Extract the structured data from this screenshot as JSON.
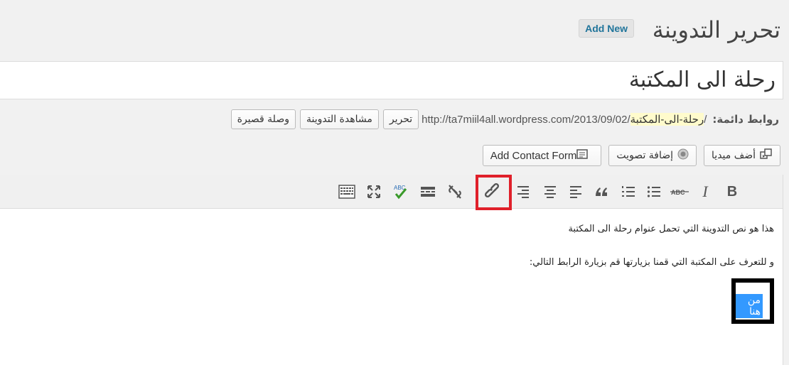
{
  "header": {
    "title": "تحرير التدوينة",
    "add_new": "Add New"
  },
  "post": {
    "title": "رحلة الى المكتبة"
  },
  "permalink": {
    "label": "روابط دائمة:",
    "base": "http://ta7miil4all.wordpress.com/2013/09/02/",
    "slug": "رحلة-الى-المكتبة",
    "suffix": "/",
    "edit_button": "تحرير",
    "view_button": "مشاهدة التدوينة",
    "shortlink_button": "وصلة قصيرة"
  },
  "media_buttons": {
    "add_media": "أضف ميديا",
    "add_poll": "إضافة تصويت",
    "add_contact_form": "Add Contact Form"
  },
  "toolbar": {
    "bold": "B",
    "italic": "I",
    "strike": "ABC"
  },
  "content": {
    "paragraph1": "هذا هو نص التدوينة التي تحمل عنوام رحلة الى المكتبة",
    "paragraph2": "و للتعرف على المكتبة التي قمنا بزيارتها قم بزيارة الرابط التالي:",
    "link_text": "من هنا"
  },
  "colors": {
    "highlight_red": "#e0202a",
    "selection_blue": "#3399ff",
    "link_blue": "#21759b"
  }
}
